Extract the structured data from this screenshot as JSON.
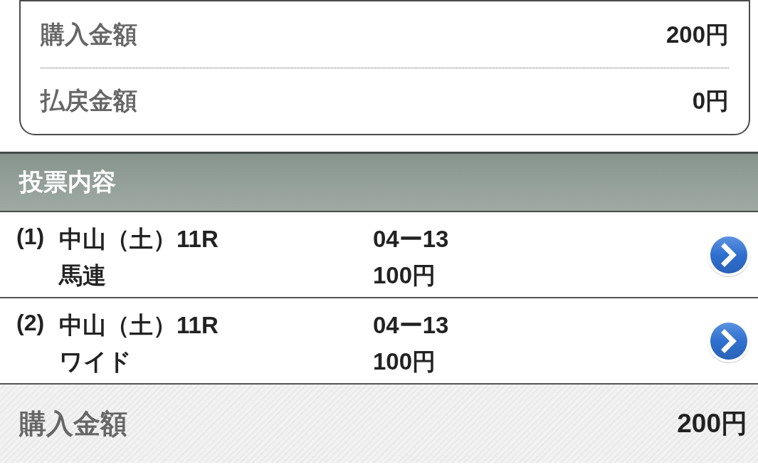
{
  "summary": {
    "rows": [
      {
        "label": "購入金額",
        "value": "200円"
      },
      {
        "label": "払戻金額",
        "value": "0円"
      }
    ]
  },
  "bets_section": {
    "title": "投票内容",
    "bets": [
      {
        "number": "(1)",
        "race": "中山（土）11R",
        "bet_type": "馬連",
        "combination": "04ー13",
        "amount": "100円"
      },
      {
        "number": "(2)",
        "race": "中山（土）11R",
        "bet_type": "ワイド",
        "combination": "04ー13",
        "amount": "100円"
      }
    ]
  },
  "footer": {
    "label": "購入金額",
    "value": "200円"
  }
}
